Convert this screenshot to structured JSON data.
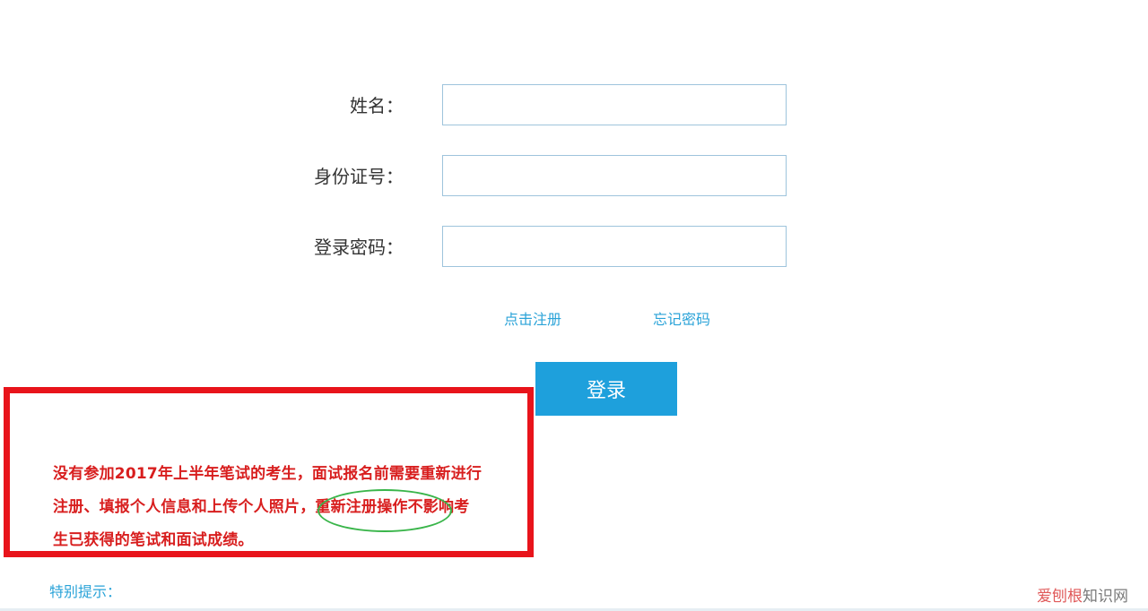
{
  "form": {
    "name_label": "姓名：",
    "id_label": "身份证号：",
    "password_label": "登录密码："
  },
  "links": {
    "register": "点击注册",
    "forgot_password": "忘记密码"
  },
  "login_button": "登录",
  "notice": {
    "line1": "没有参加2017年上半年笔试的考生，面试报名前需要重新进行",
    "line2_prefix": "注册、填报个人信息和上传个人照片，",
    "line2_highlight": "重新注册操作",
    "line2_suffix": "不影响考",
    "line3": "生已获得的笔试和面试成绩。"
  },
  "special_tip": "特别提示：",
  "watermark": {
    "brand": "爱刨根",
    "site": "知识网"
  },
  "colors": {
    "accent": "#1ea0dc",
    "link": "#2aa3d8",
    "notice_border": "#e8141b",
    "notice_text": "#d81e1e",
    "highlight_circle": "#39b54a"
  }
}
